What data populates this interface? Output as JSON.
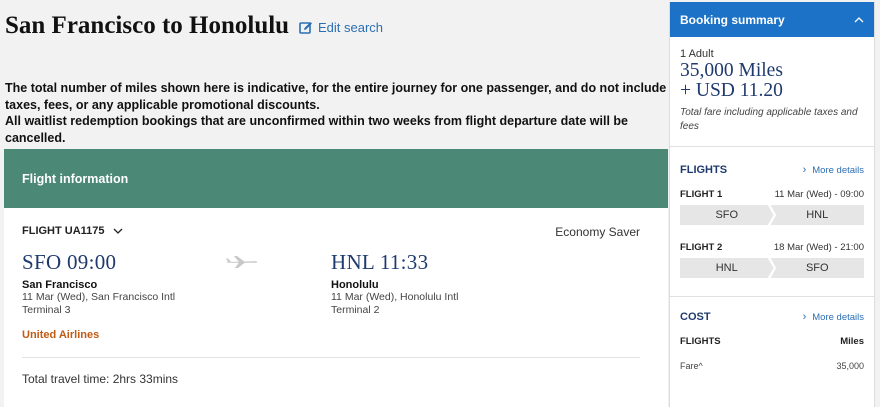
{
  "page": {
    "title": "San Francisco to Honolulu",
    "edit_search": "Edit search"
  },
  "notice": {
    "line1": "The total number of miles shown here is indicative, for the entire journey for one passenger, and do not include taxes, fees, or any applicable promotional discounts.",
    "line2": "All waitlist redemption bookings that are unconfirmed within two weeks from flight departure date will be cancelled."
  },
  "flight": {
    "section_title": "Flight information",
    "flight_number": "FLIGHT UA1175",
    "fare_class": "Economy Saver",
    "departure": {
      "code_time": "SFO 09:00",
      "city": "San Francisco",
      "date_airport": "11 Mar (Wed), San Francisco Intl",
      "terminal": "Terminal 3"
    },
    "arrival": {
      "code_time": "HNL 11:33",
      "city": "Honolulu",
      "date_airport": "11 Mar (Wed), Honolulu Intl",
      "terminal": "Terminal 2"
    },
    "airline": "United Airlines",
    "travel_time": "Total travel time: 2hrs 33mins"
  },
  "summary": {
    "title": "Booking summary",
    "passengers": "1 Adult",
    "miles": "35,000 Miles",
    "usd": "+ USD 11.20",
    "fare_note": "Total fare including applicable taxes and fees",
    "flights_title": "FLIGHTS",
    "more_details": "More details",
    "legs": [
      {
        "label": "FLIGHT 1",
        "date": "11 Mar (Wed) - 09:00",
        "from": "SFO",
        "to": "HNL"
      },
      {
        "label": "FLIGHT 2",
        "date": "18 Mar (Wed) - 21:00",
        "from": "HNL",
        "to": "SFO"
      }
    ],
    "cost_title": "COST",
    "cost_flights": "FLIGHTS",
    "cost_unit": "Miles",
    "fare_label": "Fare^",
    "fare_value": "35,000"
  },
  "colors": {
    "accent_blue": "#1c72c6",
    "flight_header_green": "#4b8876",
    "airline_orange": "#c15b13",
    "heading_navy": "#1f3a6e"
  },
  "icons": [
    "edit-icon",
    "chevron-down-icon",
    "plane-icon",
    "chevron-up-icon",
    "caret-right-icon"
  ]
}
